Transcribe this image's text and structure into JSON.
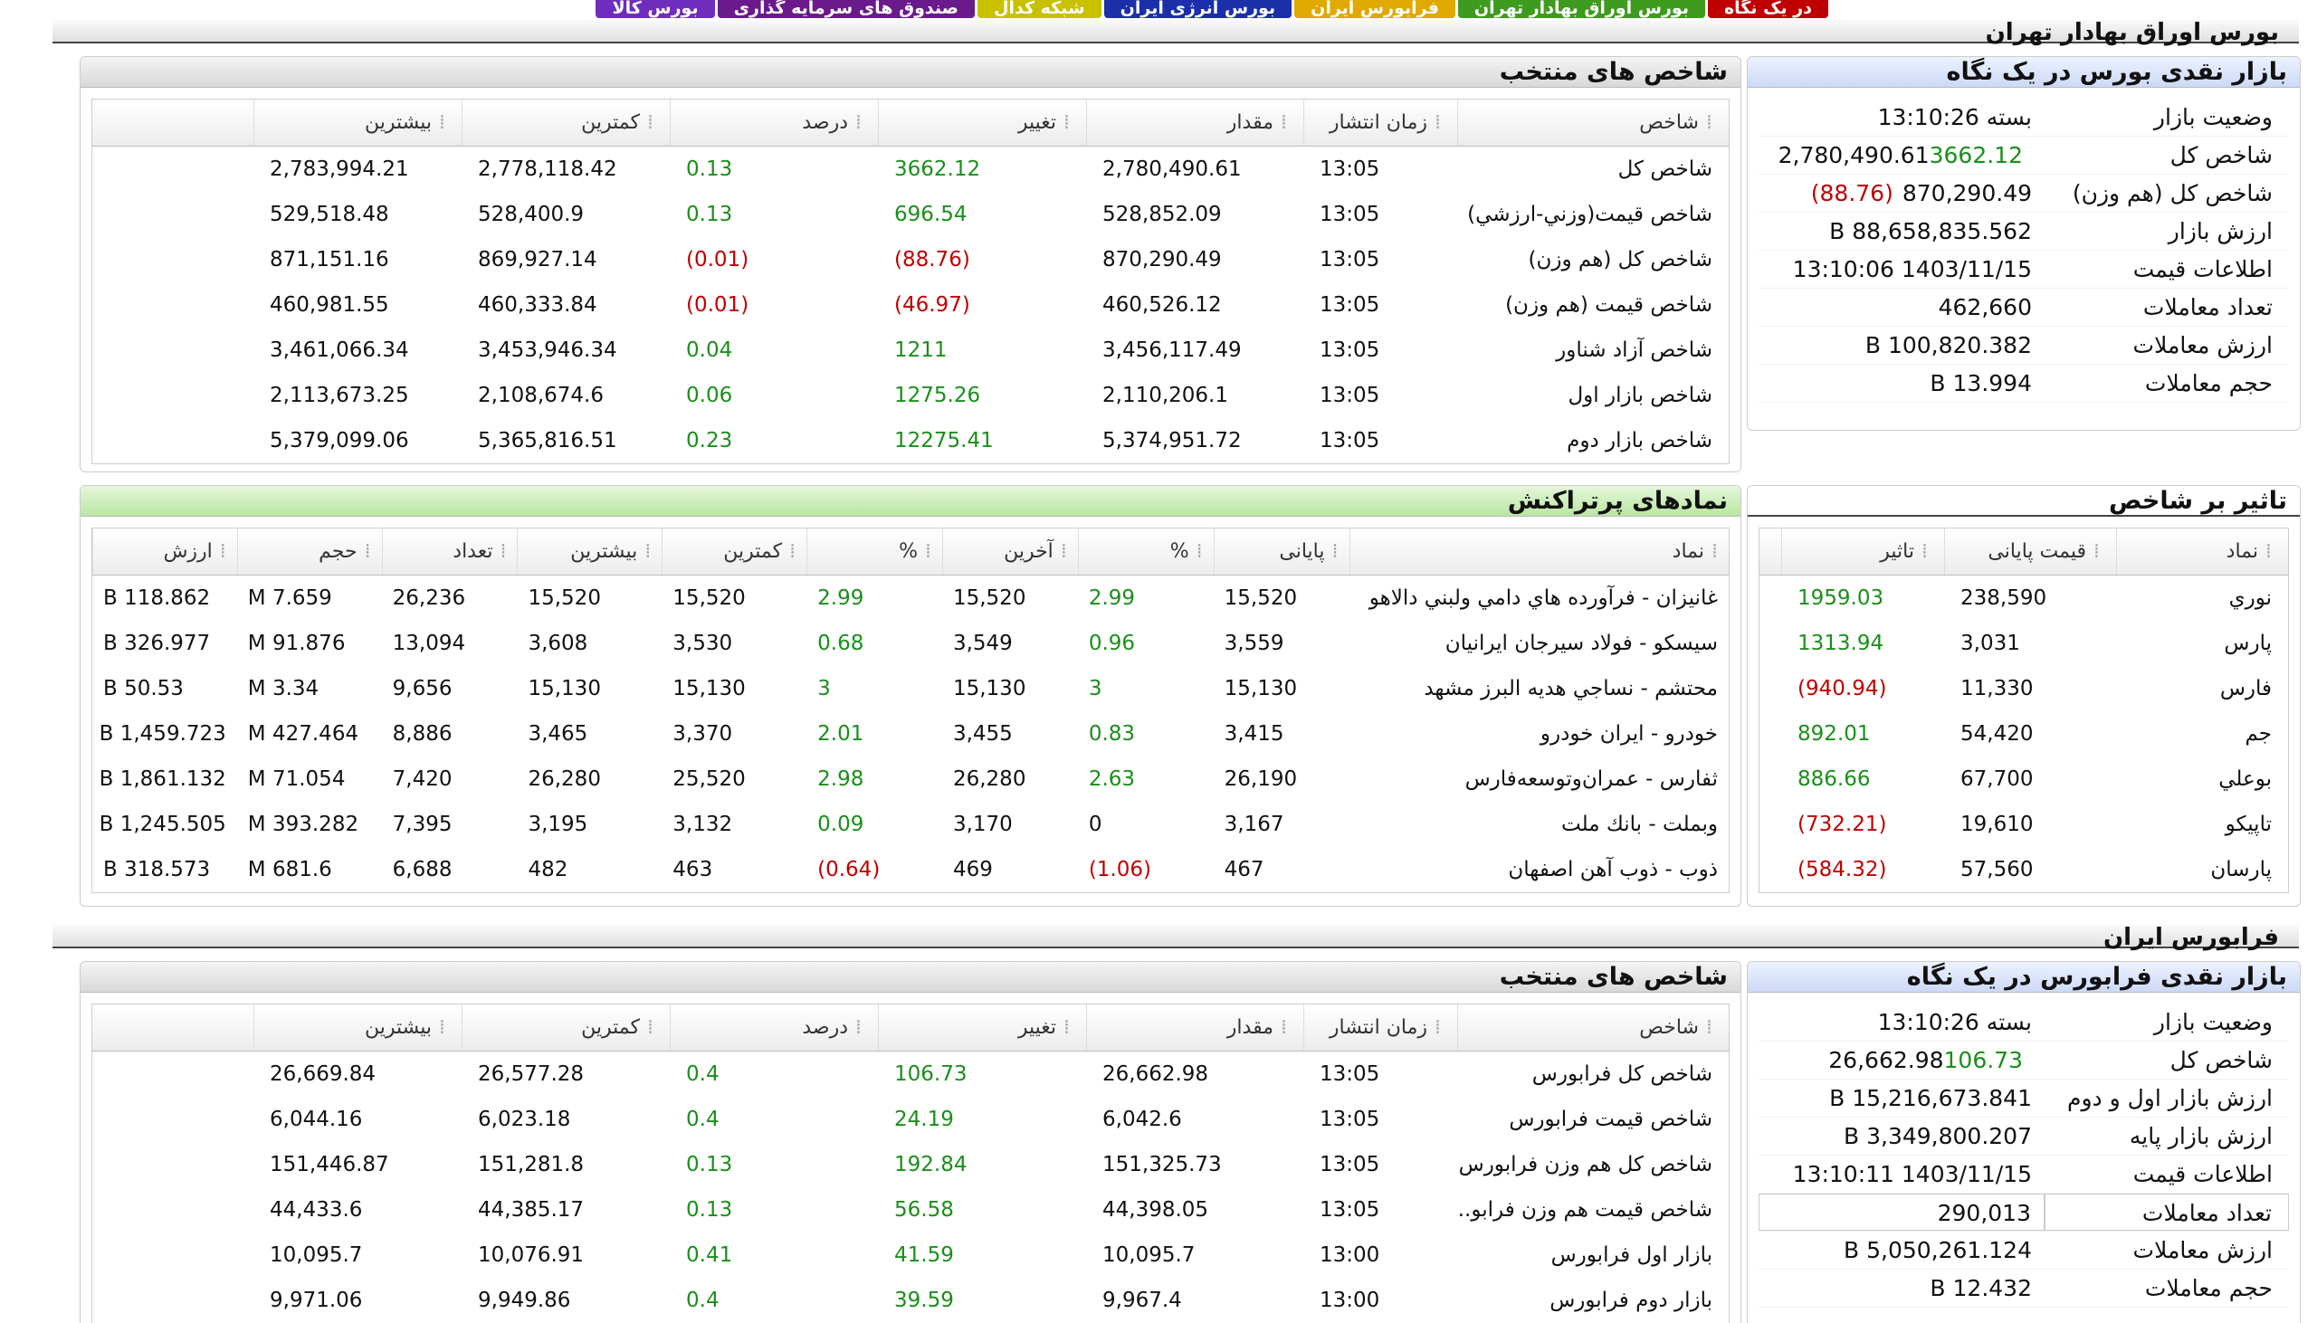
{
  "tabs": [
    {
      "label": "در یک نگاه",
      "color": "#c00000"
    },
    {
      "label": "بورس اوراق بهادار تهران",
      "color": "#3f9b1f"
    },
    {
      "label": "فرابورس ایران",
      "color": "#e0a800"
    },
    {
      "label": "بورس انرژی ایران",
      "color": "#1b2fa8"
    },
    {
      "label": "شبکه کدال",
      "color": "#c9c000"
    },
    {
      "label": "صندوق های سرمایه گذاری",
      "color": "#6a1a8a"
    },
    {
      "label": "بورس کالا",
      "color": "#6f2dbd"
    }
  ],
  "tse": {
    "section_title": "بورس اوراق بهادار تهران",
    "glance": {
      "title": "بازار نقدی بورس در یک نگاه",
      "rows": [
        {
          "k": "وضعیت بازار",
          "v": "بسته 13:10:26"
        },
        {
          "k": "شاخص کل",
          "v": "2,780,490.61",
          "change": "3662.12",
          "dir": "pos"
        },
        {
          "k": "شاخص کل (هم وزن)",
          "v": "870,290.49",
          "change": "(88.76)",
          "dir": "neg"
        },
        {
          "k": "ارزش بازار",
          "v": "88,658,835.562 B"
        },
        {
          "k": "اطلاعات قیمت",
          "v": "1403/11/15 13:10:06"
        },
        {
          "k": "تعداد معاملات",
          "v": "462,660"
        },
        {
          "k": "ارزش معاملات",
          "v": "100,820.382 B"
        },
        {
          "k": "حجم معاملات",
          "v": "13.994 B"
        }
      ]
    },
    "indices": {
      "title": "شاخص های منتخب",
      "headers": [
        "شاخص",
        "زمان انتشار",
        "مقدار",
        "تغییر",
        "درصد",
        "کمترین",
        "بیشترین"
      ],
      "rows": [
        [
          "شاخص كل",
          "13:05",
          "2,780,490.61",
          "3662.12",
          "0.13",
          "2,778,118.42",
          "2,783,994.21",
          "pos"
        ],
        [
          "شاخص قيمت(وزني-ارزشي)",
          "13:05",
          "528,852.09",
          "696.54",
          "0.13",
          "528,400.9",
          "529,518.48",
          "pos"
        ],
        [
          "شاخص كل (هم وزن)",
          "13:05",
          "870,290.49",
          "(88.76)",
          "(0.01)",
          "869,927.14",
          "871,151.16",
          "neg"
        ],
        [
          "شاخص قيمت (هم وزن)",
          "13:05",
          "460,526.12",
          "(46.97)",
          "(0.01)",
          "460,333.84",
          "460,981.55",
          "neg"
        ],
        [
          "شاخص آزاد شناور",
          "13:05",
          "3,456,117.49",
          "1211",
          "0.04",
          "3,453,946.34",
          "3,461,066.34",
          "pos"
        ],
        [
          "شاخص بازار اول",
          "13:05",
          "2,110,206.1",
          "1275.26",
          "0.06",
          "2,108,674.6",
          "2,113,673.25",
          "pos"
        ],
        [
          "شاخص بازار دوم",
          "13:05",
          "5,374,951.72",
          "12275.41",
          "0.23",
          "5,365,816.51",
          "5,379,099.06",
          "pos"
        ]
      ]
    },
    "impact": {
      "title": "تاثیر بر شاخص",
      "headers": [
        "نماد",
        "قیمت پایانی",
        "تاثیر"
      ],
      "rows": [
        [
          "نوري",
          "238,590",
          "1959.03",
          "pos"
        ],
        [
          "پارس",
          "3,031",
          "1313.94",
          "pos"
        ],
        [
          "فارس",
          "11,330",
          "(940.94)",
          "neg"
        ],
        [
          "جم",
          "54,420",
          "892.01",
          "pos"
        ],
        [
          "بوعلي",
          "67,700",
          "886.66",
          "pos"
        ],
        [
          "تاپيكو",
          "19,610",
          "(732.21)",
          "neg"
        ],
        [
          "پارسان",
          "57,560",
          "(584.32)",
          "neg"
        ]
      ]
    },
    "active": {
      "title": "نمادهای پرتراکنش",
      "headers": [
        "نماد",
        "پایانی",
        "%",
        "آخرین",
        "%",
        "کمترین",
        "بیشترین",
        "تعداد",
        "حجم",
        "ارزش"
      ],
      "rows": [
        [
          "غانيزان - فرآورده هاي دامي ولبني دالاهو",
          "15,520",
          "2.99",
          "15,520",
          "2.99",
          "15,520",
          "15,520",
          "26,236",
          "7.659 M",
          "118.862 B",
          "pos",
          "pos"
        ],
        [
          "سيسكو - فولاد سيرجان ايرانيان",
          "3,559",
          "0.96",
          "3,549",
          "0.68",
          "3,530",
          "3,608",
          "13,094",
          "91.876 M",
          "326.977 B",
          "pos",
          "pos"
        ],
        [
          "محتشم - نساجي هديه البرز مشهد",
          "15,130",
          "3",
          "15,130",
          "3",
          "15,130",
          "15,130",
          "9,656",
          "3.34 M",
          "50.53 B",
          "pos",
          "pos"
        ],
        [
          "خودرو - ايران خودرو",
          "3,415",
          "0.83",
          "3,455",
          "2.01",
          "3,370",
          "3,465",
          "8,886",
          "427.464 M",
          "1,459.723 B",
          "pos",
          "pos"
        ],
        [
          "ثفارس - عمران‌وتوسعه‌فارس",
          "26,190",
          "2.63",
          "26,280",
          "2.98",
          "25,520",
          "26,280",
          "7,420",
          "71.054 M",
          "1,861.132 B",
          "pos",
          "pos"
        ],
        [
          "وبملت - بانك ملت",
          "3,167",
          "0",
          "3,170",
          "0.09",
          "3,132",
          "3,195",
          "7,395",
          "393.282 M",
          "1,245.505 B",
          "none",
          "pos"
        ],
        [
          "ذوب - ذوب آهن  اصفهان",
          "467",
          "(1.06)",
          "469",
          "(0.64)",
          "463",
          "482",
          "6,688",
          "681.6 M",
          "318.573 B",
          "neg",
          "neg"
        ]
      ]
    }
  },
  "ifb": {
    "section_title": "فرابورس ایران",
    "glance": {
      "title": "بازار نقدی فرابورس در یک نگاه",
      "rows": [
        {
          "k": "وضعیت بازار",
          "v": "بسته 13:10:26"
        },
        {
          "k": "شاخص کل",
          "v": "26,662.98",
          "change": "106.73",
          "dir": "pos"
        },
        {
          "k": "ارزش بازار اول و دوم",
          "v": "15,216,673.841 B"
        },
        {
          "k": "ارزش بازار پایه",
          "v": "3,349,800.207 B"
        },
        {
          "k": "اطلاعات قیمت",
          "v": "1403/11/15 13:10:11"
        },
        {
          "k": "تعداد معاملات",
          "v": "290,013"
        },
        {
          "k": "ارزش معاملات",
          "v": "5,050,261.124 B"
        },
        {
          "k": "حجم معاملات",
          "v": "12.432 B"
        }
      ]
    },
    "indices": {
      "title": "شاخص های منتخب",
      "headers": [
        "شاخص",
        "زمان انتشار",
        "مقدار",
        "تغییر",
        "درصد",
        "کمترین",
        "بیشترین"
      ],
      "rows": [
        [
          "شاخص كل فرابورس",
          "13:05",
          "26,662.98",
          "106.73",
          "0.4",
          "26,577.28",
          "26,669.84",
          "pos"
        ],
        [
          "شاخص قيمت فرابورس",
          "13:05",
          "6,042.6",
          "24.19",
          "0.4",
          "6,023.18",
          "6,044.16",
          "pos"
        ],
        [
          "شاخص كل هم وزن فرابورس",
          "13:05",
          "151,325.73",
          "192.84",
          "0.13",
          "151,281.8",
          "151,446.87",
          "pos"
        ],
        [
          "شاخص قيمت هم وزن فرابو...",
          "13:05",
          "44,398.05",
          "56.58",
          "0.13",
          "44,385.17",
          "44,433.6",
          "pos"
        ],
        [
          "بازار اول فرابورس",
          "13:00",
          "10,095.7",
          "41.59",
          "0.41",
          "10,076.91",
          "10,095.7",
          "pos"
        ],
        [
          "بازار دوم فرابورس",
          "13:00",
          "9,967.4",
          "39.59",
          "0.4",
          "9,949.86",
          "9,971.06",
          "pos"
        ]
      ]
    }
  }
}
